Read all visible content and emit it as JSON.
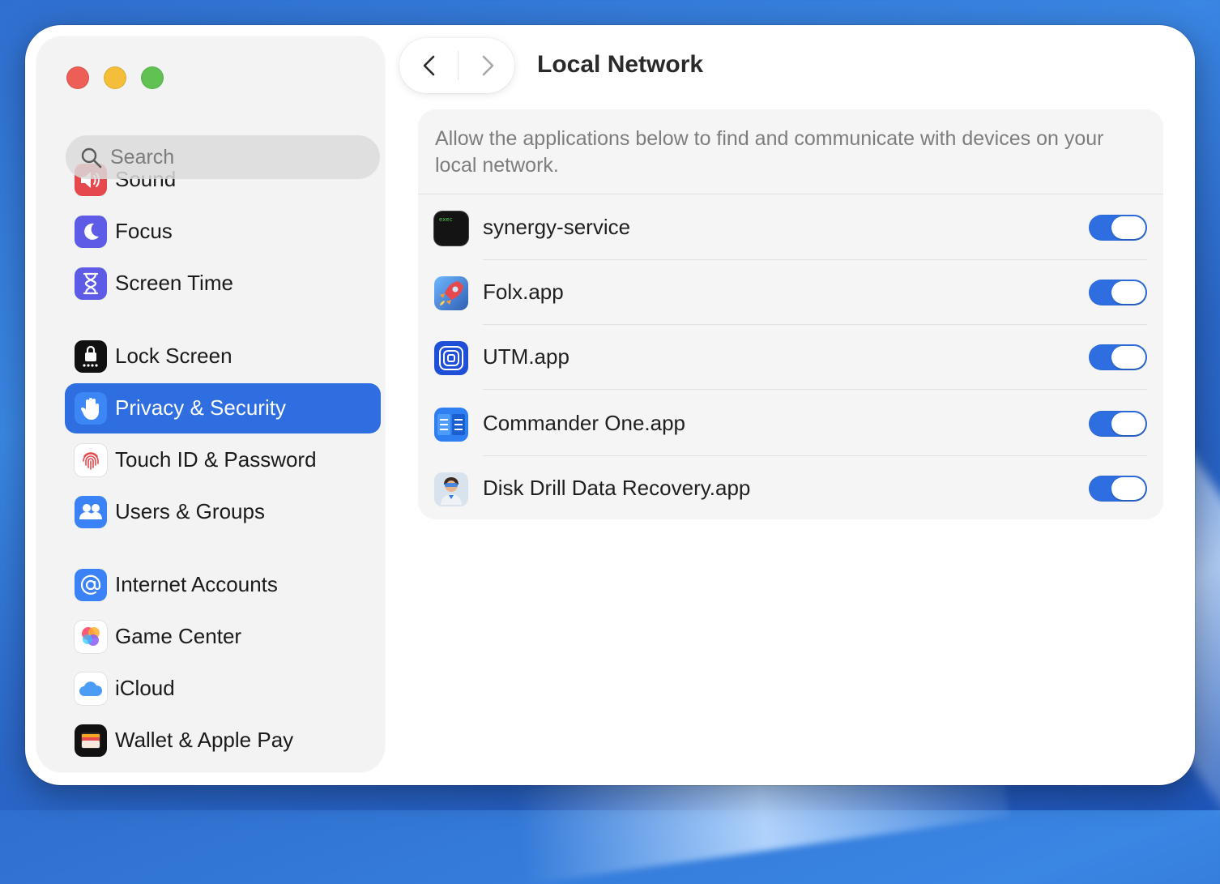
{
  "window": {
    "title": "Local Network"
  },
  "search": {
    "placeholder": "Search"
  },
  "sidebar": {
    "items": [
      {
        "label": "Sound",
        "icon": "speaker-icon",
        "color": "#e5484d"
      },
      {
        "label": "Focus",
        "icon": "moon-icon",
        "color": "#5e5ce6"
      },
      {
        "label": "Screen Time",
        "icon": "hourglass-icon",
        "color": "#5e5ce6"
      },
      {
        "label": "Lock Screen",
        "icon": "lock-icon",
        "color": "#111111"
      },
      {
        "label": "Privacy & Security",
        "icon": "hand-icon",
        "color": "#2e6ee0",
        "selected": true
      },
      {
        "label": "Touch ID & Password",
        "icon": "fingerprint-icon",
        "color": "#ffffff"
      },
      {
        "label": "Users & Groups",
        "icon": "users-icon",
        "color": "#3b82f6"
      },
      {
        "label": "Internet Accounts",
        "icon": "at-icon",
        "color": "#3b82f6"
      },
      {
        "label": "Game Center",
        "icon": "game-center-icon",
        "color": "#ffffff"
      },
      {
        "label": "iCloud",
        "icon": "cloud-icon",
        "color": "#ffffff"
      },
      {
        "label": "Wallet & Apple Pay",
        "icon": "wallet-icon",
        "color": "#111111"
      }
    ]
  },
  "main": {
    "description": "Allow the applications below to find and communicate with devices on your local network.",
    "apps": [
      {
        "name": "synergy-service",
        "icon": "terminal-exec-icon",
        "enabled": true
      },
      {
        "name": "Folx.app",
        "icon": "folx-rocket-icon",
        "enabled": true
      },
      {
        "name": "UTM.app",
        "icon": "utm-icon",
        "enabled": true
      },
      {
        "name": "Commander One.app",
        "icon": "commander-one-icon",
        "enabled": true
      },
      {
        "name": "Disk Drill Data Recovery.app",
        "icon": "disk-drill-icon",
        "enabled": true
      }
    ]
  },
  "colors": {
    "accent": "#2e6ee0",
    "close": "#ed5f56",
    "minimize": "#f4be3b",
    "maximize": "#5fc253"
  }
}
